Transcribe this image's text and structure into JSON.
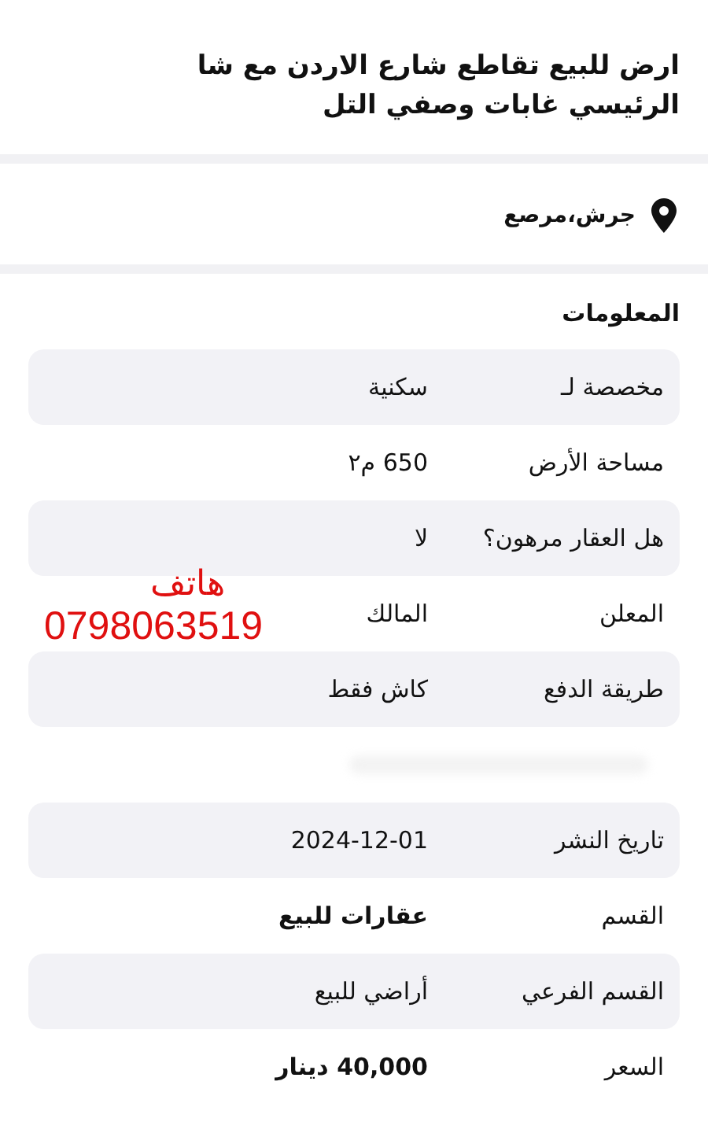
{
  "title_lines": [
    "ارض للبيع تقاطع شارع الاردن مع شا",
    "الرئيسي غابات وصفي التل"
  ],
  "location": "جرش،مرصع",
  "section_title": "المعلومات",
  "rows": [
    {
      "kind": "field",
      "label": "مخصصة لـ",
      "value": "سكنية",
      "bold": false
    },
    {
      "kind": "field",
      "label": "مساحة الأرض",
      "value": "650 م٢",
      "bold": false
    },
    {
      "kind": "field",
      "label": "هل العقار مرهون؟",
      "value": "لا",
      "bold": false
    },
    {
      "kind": "field",
      "label": "المعلن",
      "value": "المالك",
      "bold": false
    },
    {
      "kind": "field",
      "label": "طريقة الدفع",
      "value": "كاش فقط",
      "bold": false
    },
    {
      "kind": "blurred"
    },
    {
      "kind": "field",
      "label": "تاريخ النشر",
      "value": "2024-12-01",
      "bold": false
    },
    {
      "kind": "field",
      "label": "القسم",
      "value": "عقارات للبيع",
      "bold": true
    },
    {
      "kind": "field",
      "label": "القسم الفرعي",
      "value": "أراضي للبيع",
      "bold": false
    },
    {
      "kind": "field",
      "label": "السعر",
      "value": "40,000 دينار",
      "bold": true
    }
  ],
  "phone_note": {
    "label": "هاتف",
    "number": "0798063519"
  }
}
